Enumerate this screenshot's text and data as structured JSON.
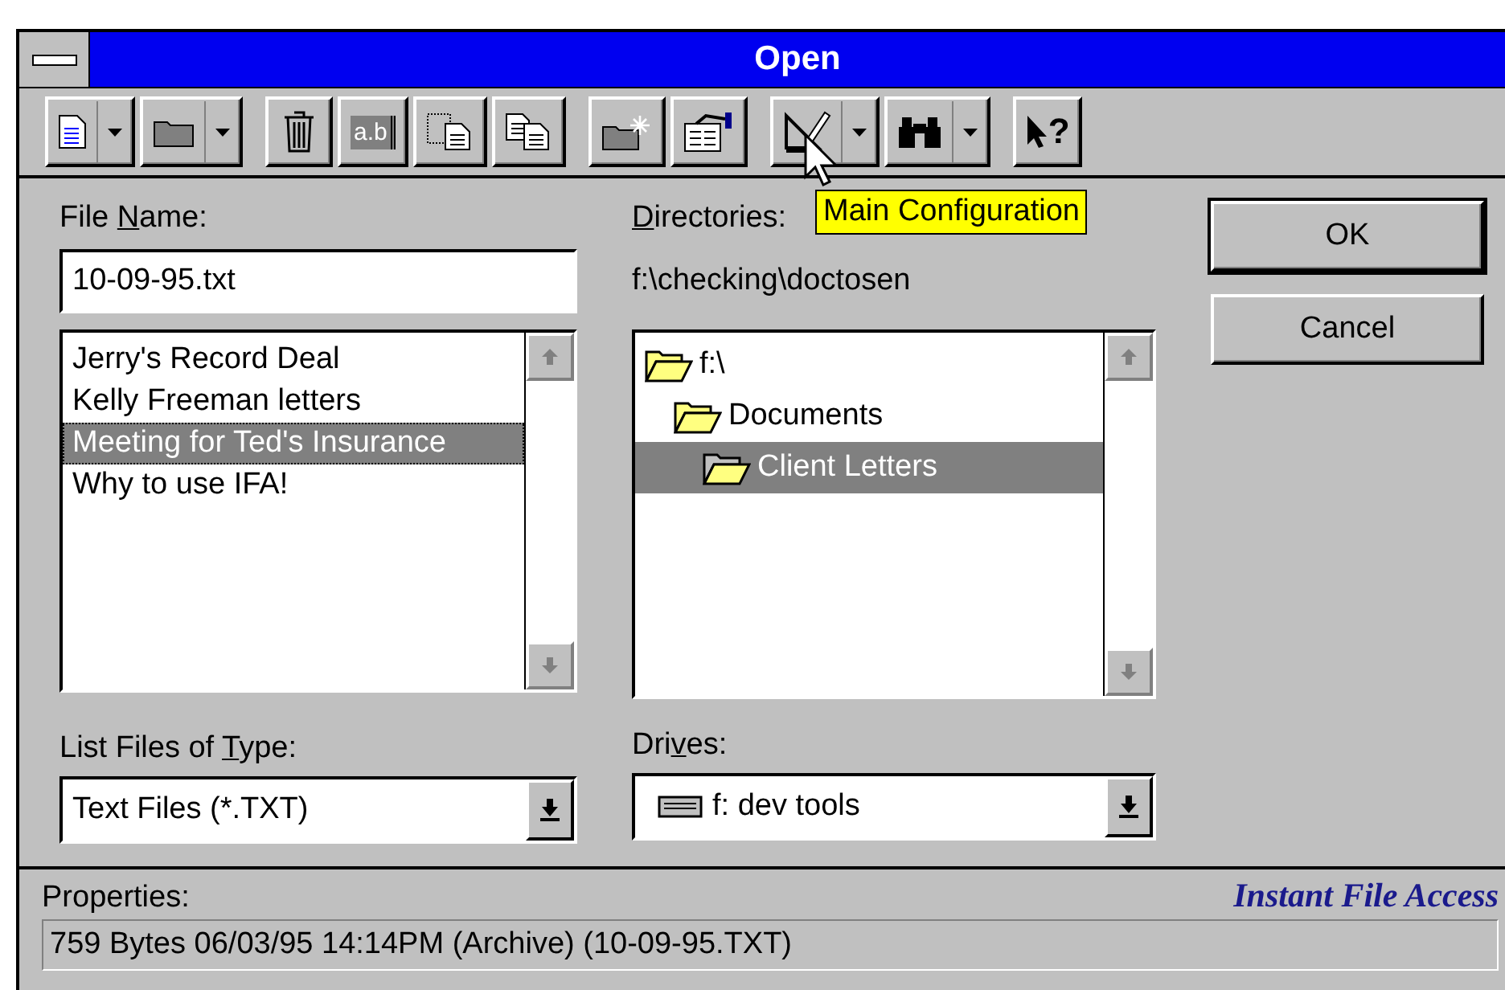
{
  "window": {
    "title": "Open"
  },
  "toolbar": [
    [
      {
        "kind": "new-document",
        "dropdown": true
      },
      {
        "kind": "folder",
        "dropdown": true
      }
    ],
    [
      {
        "kind": "trash",
        "dropdown": false
      },
      {
        "kind": "rename",
        "dropdown": false,
        "label": "a.b"
      },
      {
        "kind": "copy-to",
        "dropdown": false
      },
      {
        "kind": "copy",
        "dropdown": false
      }
    ],
    [
      {
        "kind": "new-folder",
        "dropdown": false
      },
      {
        "kind": "properties",
        "dropdown": false
      }
    ],
    [
      {
        "kind": "tools",
        "dropdown": true
      },
      {
        "kind": "search",
        "dropdown": true
      }
    ],
    [
      {
        "kind": "help",
        "dropdown": false,
        "label": "?"
      }
    ]
  ],
  "tooltip": "Main Configuration",
  "file_name": {
    "label": {
      "before": "File ",
      "key": "N",
      "after": "ame:"
    },
    "value": "10-09-95.txt",
    "files": [
      {
        "name": "Jerry's Record Deal",
        "selected": false
      },
      {
        "name": "Kelly Freeman letters",
        "selected": false
      },
      {
        "name": "Meeting for Ted's Insurance",
        "selected": true
      },
      {
        "name": "Why to use IFA!",
        "selected": false
      }
    ]
  },
  "directories": {
    "label": {
      "key": "D",
      "after": "irectories:"
    },
    "path": "f:\\checking\\doctosen",
    "tree": [
      {
        "name": "f:\\",
        "selected": false,
        "children": [
          {
            "name": "Documents",
            "selected": false,
            "children": [
              {
                "name": "Client Letters",
                "selected": true
              }
            ]
          }
        ]
      }
    ]
  },
  "file_type": {
    "label": {
      "before": "List Files of ",
      "key": "T",
      "after": "ype:"
    },
    "value": "Text Files (*.TXT)"
  },
  "drives": {
    "label": {
      "before": "Dri",
      "key": "v",
      "after": "es:"
    },
    "value": "f: dev tools"
  },
  "buttons": [
    {
      "label": "OK",
      "default": true
    },
    {
      "label": "Cancel",
      "default": false
    }
  ],
  "status_bar": {
    "label": "Properties:",
    "brand": "Instant File Access",
    "info": "759 Bytes 06/03/95 14:14PM (Archive) (10-09-95.TXT)"
  }
}
